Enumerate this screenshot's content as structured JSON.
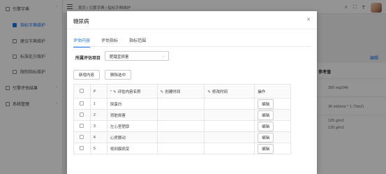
{
  "sidebar": {
    "group_dict": "引擎字典",
    "items": [
      {
        "label": "指标字典维护",
        "active": true
      },
      {
        "label": "建议字典维护",
        "active": false
      },
      {
        "label": "标准处方维护",
        "active": false
      },
      {
        "label": "限制指标维护",
        "active": false
      }
    ],
    "group_eval": "引擎评估结果",
    "group_sys": "系统管理"
  },
  "topbar": {
    "breadcrumb": "首页  /  引擎字典  /  指标字典维护",
    "icons": [
      "search-icon",
      "fullscreen-icon",
      "text-size-icon"
    ]
  },
  "background_panel": {
    "title": "参考值",
    "link": "编辑",
    "values": [
      "300 mg/24h",
      "30 ml/(min * 1.73m2)",
      "125 g/m2",
      "120 g/m2"
    ]
  },
  "modal": {
    "title": "糖尿病",
    "tabs": [
      {
        "label": "评估内容",
        "active": true
      },
      {
        "label": "评估指标",
        "active": false
      },
      {
        "label": "指标范围",
        "active": false
      }
    ],
    "filter_label": "所属评估项目",
    "filter_value": "肥踏宜损害",
    "buttons": {
      "add": "新增内容",
      "delete": "删除选中"
    },
    "table": {
      "headers": {
        "index": "#",
        "name": "评估内容名称",
        "created": "创建时间",
        "modified": "修改时间",
        "action": "操作"
      },
      "rows": [
        {
          "index": "1",
          "name": "尿蛋白",
          "created": "",
          "modified": "",
          "action": "编辑"
        },
        {
          "index": "2",
          "name": "肾脏损害",
          "created": "",
          "modified": "",
          "action": "编辑"
        },
        {
          "index": "3",
          "name": "左心室肥厚",
          "created": "",
          "modified": "",
          "action": "编辑"
        },
        {
          "index": "4",
          "name": "心房颤动",
          "created": "",
          "modified": "",
          "action": "编辑"
        },
        {
          "index": "5",
          "name": "视网膜病变",
          "created": "",
          "modified": "",
          "action": "编辑"
        }
      ]
    }
  }
}
